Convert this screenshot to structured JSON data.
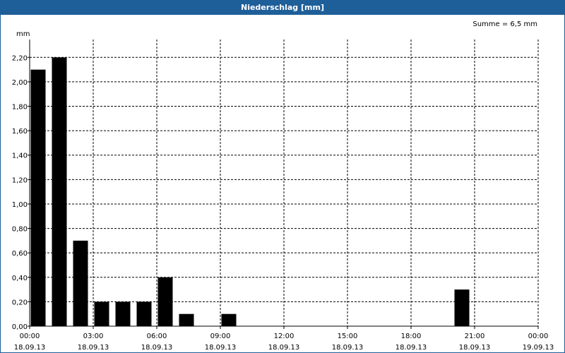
{
  "window": {
    "title": "Niederschlag [mm]"
  },
  "chart_data": {
    "type": "bar",
    "title": "Niederschlag [mm]",
    "summary": "Summe = 6,5 mm",
    "ylabel": "mm",
    "ylim": [
      0,
      2.3
    ],
    "yticks": [
      "0,00",
      "0,20",
      "0,40",
      "0,60",
      "0,80",
      "1,00",
      "1,20",
      "1,40",
      "1,60",
      "1,80",
      "2,00",
      "2,20"
    ],
    "ytick_values": [
      0,
      0.2,
      0.4,
      0.6,
      0.8,
      1.0,
      1.2,
      1.4,
      1.6,
      1.8,
      2.0,
      2.2
    ],
    "x_range_hours": [
      0,
      24
    ],
    "xticks": [
      {
        "hour": 0,
        "time": "00:00",
        "date": "18.09.13"
      },
      {
        "hour": 3,
        "time": "03:00",
        "date": "18.09.13"
      },
      {
        "hour": 6,
        "time": "06:00",
        "date": "18.09.13"
      },
      {
        "hour": 9,
        "time": "09:00",
        "date": "18.09.13"
      },
      {
        "hour": 12,
        "time": "12:00",
        "date": "18.09.13"
      },
      {
        "hour": 15,
        "time": "15:00",
        "date": "18.09.13"
      },
      {
        "hour": 18,
        "time": "18:00",
        "date": "18.09.13"
      },
      {
        "hour": 21,
        "time": "21:00",
        "date": "18.09.13"
      },
      {
        "hour": 24,
        "time": "00:00",
        "date": "19.09.13"
      }
    ],
    "grid": true,
    "bar_color": "#000000",
    "bars": [
      {
        "hour": 0.0,
        "value": 2.1
      },
      {
        "hour": 1.0,
        "value": 2.2
      },
      {
        "hour": 2.0,
        "value": 0.7
      },
      {
        "hour": 3.0,
        "value": 0.2
      },
      {
        "hour": 4.0,
        "value": 0.2
      },
      {
        "hour": 5.0,
        "value": 0.2
      },
      {
        "hour": 6.0,
        "value": 0.4
      },
      {
        "hour": 7.0,
        "value": 0.1
      },
      {
        "hour": 9.0,
        "value": 0.1
      },
      {
        "hour": 20.0,
        "value": 0.3
      }
    ]
  }
}
